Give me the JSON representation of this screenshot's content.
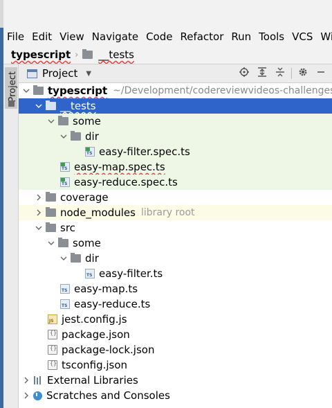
{
  "menubar": {
    "items": [
      "File",
      "Edit",
      "View",
      "Navigate",
      "Code",
      "Refactor",
      "Run",
      "Tools",
      "VCS",
      "Win"
    ]
  },
  "breadcrumb": {
    "root": "typescript",
    "child": "__tests"
  },
  "side_strip": {
    "tab_label": "Project"
  },
  "panel": {
    "title": "Project",
    "tool_icons": [
      "locate-icon",
      "expand-all-icon",
      "collapse-all-icon",
      "gear-icon",
      "minimize-icon"
    ]
  },
  "tree": {
    "root_name": "typescript",
    "root_path": "~/Development/codereviewvideos-challenges/m",
    "tests_folder": "__tests",
    "tests_some": "some",
    "tests_dir": "dir",
    "tests_easy_filter_spec": "easy-filter.spec.ts",
    "tests_easy_map_spec": "easy-map.spec.ts",
    "tests_easy_reduce_spec": "easy-reduce.spec.ts",
    "coverage": "coverage",
    "node_modules": "node_modules",
    "node_modules_hint": "library root",
    "src": "src",
    "src_some": "some",
    "src_dir": "dir",
    "src_easy_filter": "easy-filter.ts",
    "src_easy_map": "easy-map.ts",
    "src_easy_reduce": "easy-reduce.ts",
    "jest_config": "jest.config.js",
    "package_json": "package.json",
    "package_lock": "package-lock.json",
    "tsconfig": "tsconfig.json",
    "external_libraries": "External Libraries",
    "scratches": "Scratches and Consoles"
  },
  "colors": {
    "selection": "#2f65ca",
    "test_background": "#eef7e6",
    "excluded_background": "#fbfbe6",
    "hint_text": "#8a8a8a"
  }
}
